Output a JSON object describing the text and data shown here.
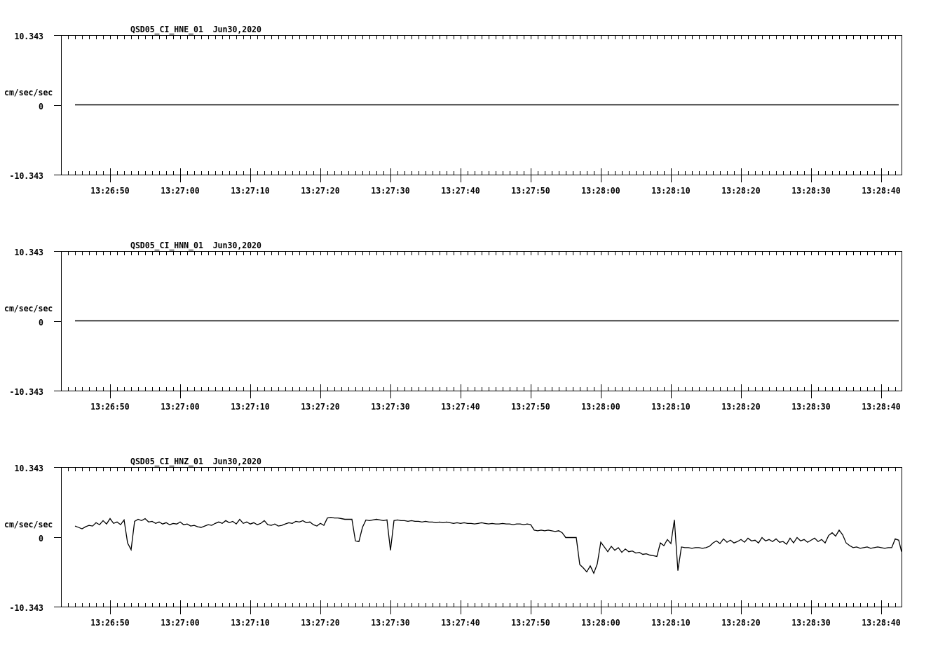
{
  "plots": [
    {
      "chart_data": {
        "type": "line",
        "title": "QSD05_CI_HNE_01  Jun30,2020",
        "ylabel": "cm/sec/sec",
        "categories": [
          null,
          null,
          "13:26:50",
          null,
          null,
          null,
          "13:27:00",
          null,
          null,
          null,
          "13:27:10",
          null,
          null,
          null,
          "13:27:20",
          null,
          null,
          null,
          "13:27:30",
          null,
          null,
          null,
          "13:27:40",
          null,
          null,
          null,
          "13:27:50",
          null,
          null,
          null,
          "13:28:00",
          null,
          null,
          null,
          "13:28:10",
          null,
          null,
          null,
          "13:28:20",
          null,
          null,
          null,
          "13:28:30",
          null,
          null,
          null,
          "13:28:40",
          null
        ],
        "ylim": [
          -10.343,
          10.343
        ],
        "yticks": [
          10.343,
          0,
          -10.343
        ],
        "series": [
          {
            "color": "#000000",
            "values": [
              0,
              0,
              0,
              0,
              0,
              0,
              0,
              0,
              0,
              0,
              0,
              0,
              0,
              0,
              0,
              0,
              0,
              0,
              0,
              0,
              0,
              0,
              0,
              0,
              0,
              0,
              0,
              0,
              0,
              0,
              0,
              0,
              0,
              0,
              0,
              0,
              0,
              0,
              0,
              0,
              0,
              0,
              0,
              0,
              0,
              0,
              0,
              0
            ]
          }
        ]
      }
    },
    {
      "chart_data": {
        "type": "line",
        "title": "QSD05_CI_HNN_01  Jun30,2020",
        "ylabel": "cm/sec/sec",
        "categories": [
          null,
          null,
          "13:26:50",
          null,
          null,
          null,
          "13:27:00",
          null,
          null,
          null,
          "13:27:10",
          null,
          null,
          null,
          "13:27:20",
          null,
          null,
          null,
          "13:27:30",
          null,
          null,
          null,
          "13:27:40",
          null,
          null,
          null,
          "13:27:50",
          null,
          null,
          null,
          "13:28:00",
          null,
          null,
          null,
          "13:28:10",
          null,
          null,
          null,
          "13:28:20",
          null,
          null,
          null,
          "13:28:30",
          null,
          null,
          null,
          "13:28:40",
          null
        ],
        "ylim": [
          -10.343,
          10.343
        ],
        "yticks": [
          10.343,
          0,
          -10.343
        ],
        "series": [
          {
            "color": "#000000",
            "values": [
              0,
              0,
              0,
              0,
              0,
              0,
              0,
              0,
              0,
              0,
              0,
              0,
              0,
              0,
              0,
              0,
              0,
              0,
              0,
              0,
              0,
              0,
              0,
              0,
              0,
              0,
              0,
              0,
              0,
              0,
              0,
              0,
              0,
              0,
              0,
              0,
              0,
              0,
              0,
              0,
              0,
              0,
              0,
              0,
              0,
              0,
              0,
              0
            ]
          }
        ]
      }
    },
    {
      "chart_data": {
        "type": "line",
        "title": "QSD05_CI_HNZ_01  Jun30,2020",
        "ylabel": "cm/sec/sec",
        "categories": [
          null,
          null,
          null,
          null,
          null,
          null,
          null,
          null,
          null,
          null,
          "13:26:50",
          null,
          null,
          null,
          null,
          null,
          null,
          null,
          null,
          null,
          null,
          null,
          null,
          null,
          null,
          null,
          null,
          null,
          null,
          null,
          "13:27:00",
          null,
          null,
          null,
          null,
          null,
          null,
          null,
          null,
          null,
          null,
          null,
          null,
          null,
          null,
          null,
          null,
          null,
          null,
          null,
          "13:27:10",
          null,
          null,
          null,
          null,
          null,
          null,
          null,
          null,
          null,
          null,
          null,
          null,
          null,
          null,
          null,
          null,
          null,
          null,
          null,
          "13:27:20",
          null,
          null,
          null,
          null,
          null,
          null,
          null,
          null,
          null,
          null,
          null,
          null,
          null,
          null,
          null,
          null,
          null,
          null,
          null,
          "13:27:30",
          null,
          null,
          null,
          null,
          null,
          null,
          null,
          null,
          null,
          null,
          null,
          null,
          null,
          null,
          null,
          null,
          null,
          null,
          null,
          "13:27:40",
          null,
          null,
          null,
          null,
          null,
          null,
          null,
          null,
          null,
          null,
          null,
          null,
          null,
          null,
          null,
          null,
          null,
          null,
          null,
          "13:27:50",
          null,
          null,
          null,
          null,
          null,
          null,
          null,
          null,
          null,
          null,
          null,
          null,
          null,
          null,
          null,
          null,
          null,
          null,
          null,
          "13:28:00",
          null,
          null,
          null,
          null,
          null,
          null,
          null,
          null,
          null,
          null,
          null,
          null,
          null,
          null,
          null,
          null,
          null,
          null,
          null,
          "13:28:10",
          null,
          null,
          null,
          null,
          null,
          null,
          null,
          null,
          null,
          null,
          null,
          null,
          null,
          null,
          null,
          null,
          null,
          null,
          null,
          "13:28:20",
          null,
          null,
          null,
          null,
          null,
          null,
          null,
          null,
          null,
          null,
          null,
          null,
          null,
          null,
          null,
          null,
          null,
          null,
          null,
          "13:28:30",
          null,
          null,
          null,
          null,
          null,
          null,
          null,
          null,
          null,
          null,
          null,
          null,
          null,
          null,
          null,
          null,
          null,
          null,
          null,
          "13:28:40",
          null,
          null,
          null,
          null,
          null,
          null
        ],
        "ylim": [
          -10.343,
          10.343
        ],
        "yticks": [
          10.343,
          0,
          -10.343
        ],
        "series": [
          {
            "color": "#000000",
            "values": [
              1.6,
              1.4,
              1.2,
              1.5,
              1.7,
              1.6,
              2.1,
              1.8,
              2.4,
              1.9,
              2.7,
              2.0,
              2.2,
              1.8,
              2.5,
              -0.9,
              -1.9,
              2.3,
              2.6,
              2.4,
              2.7,
              2.2,
              2.3,
              2.0,
              2.2,
              1.9,
              2.1,
              1.8,
              2.0,
              1.9,
              2.2,
              1.8,
              1.9,
              1.6,
              1.7,
              1.5,
              1.4,
              1.6,
              1.8,
              1.7,
              2.0,
              2.2,
              2.0,
              2.4,
              2.1,
              2.3,
              1.9,
              2.6,
              2.0,
              2.2,
              1.9,
              2.1,
              1.8,
              2.0,
              2.4,
              1.8,
              1.7,
              1.9,
              1.6,
              1.7,
              1.9,
              2.1,
              2.0,
              2.3,
              2.2,
              2.4,
              2.1,
              2.2,
              1.8,
              1.6,
              2.0,
              1.7,
              2.8,
              2.9,
              2.8,
              2.8,
              2.7,
              2.6,
              2.6,
              2.6,
              -0.6,
              -0.7,
              1.4,
              2.5,
              2.4,
              2.5,
              2.6,
              2.5,
              2.4,
              2.5,
              -2.0,
              2.4,
              2.5,
              2.4,
              2.4,
              2.3,
              2.4,
              2.3,
              2.3,
              2.2,
              2.3,
              2.2,
              2.2,
              2.1,
              2.2,
              2.1,
              2.2,
              2.1,
              2.0,
              2.1,
              2.0,
              2.1,
              2.0,
              2.0,
              1.9,
              2.0,
              2.1,
              2.0,
              1.9,
              2.0,
              1.9,
              1.9,
              2.0,
              1.9,
              1.9,
              1.8,
              1.9,
              1.9,
              1.8,
              1.9,
              1.8,
              1.0,
              0.9,
              1.0,
              0.9,
              1.0,
              0.9,
              0.8,
              0.9,
              0.6,
              -0.1,
              -0.1,
              -0.1,
              -0.1,
              -4.1,
              -4.6,
              -5.2,
              -4.3,
              -5.4,
              -4.0,
              -0.8,
              -1.5,
              -2.2,
              -1.4,
              -2.0,
              -1.6,
              -2.3,
              -1.8,
              -2.2,
              -2.1,
              -2.4,
              -2.3,
              -2.6,
              -2.5,
              -2.7,
              -2.8,
              -2.9,
              -0.9,
              -1.3,
              -0.4,
              -1.0,
              2.5,
              -5.0,
              -1.5,
              -1.6,
              -1.6,
              -1.7,
              -1.6,
              -1.6,
              -1.7,
              -1.6,
              -1.4,
              -0.9,
              -0.6,
              -1.0,
              -0.3,
              -0.8,
              -0.5,
              -0.9,
              -0.7,
              -0.4,
              -0.8,
              -0.2,
              -0.6,
              -0.5,
              -0.9,
              -0.1,
              -0.6,
              -0.4,
              -0.7,
              -0.3,
              -0.8,
              -0.7,
              -1.1,
              -0.2,
              -0.9,
              -0.1,
              -0.6,
              -0.4,
              -0.8,
              -0.5,
              -0.2,
              -0.7,
              -0.4,
              -0.9,
              0.2,
              0.6,
              0.1,
              1.0,
              0.3,
              -0.9,
              -1.3,
              -1.6,
              -1.5,
              -1.7,
              -1.6,
              -1.5,
              -1.7,
              -1.6,
              -1.5,
              -1.6,
              -1.7,
              -1.6,
              -1.6,
              -0.3,
              -0.5,
              -2.2
            ]
          }
        ]
      }
    }
  ]
}
